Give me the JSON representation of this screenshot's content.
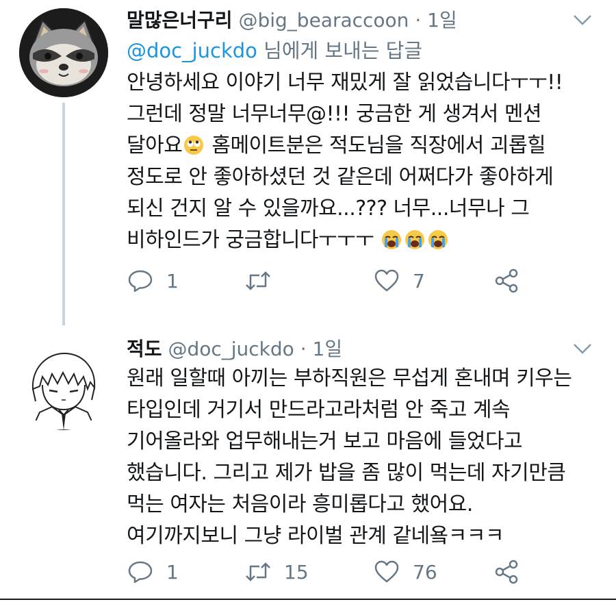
{
  "tweets": [
    {
      "name": "말많은너구리",
      "handle": "@big_bearaccoon",
      "dot": "·",
      "time": "1일",
      "reply_to": {
        "mention": "@doc_juckdo",
        "suffix": " 님에게 보내는 답글"
      },
      "avatar_icon": "raccoon-avatar",
      "body_lines": [
        "안녕하세요 이야기 너무 재밌게 잘 읽었습니다ㅜㅜ!!",
        "그런데 정말 너무너무@!!! 궁금한 게 생겨서 멘션",
        "달아요",
        " 홈메이트분은 적도님을 직장에서 괴롭힐",
        "정도로 안 좋아하셨던 것 같은데 어쩌다가 좋아하게",
        "되신 건지 알 수 있을까요...??? 너무...너무나 그",
        "비하인드가 궁금합니다ㅜㅜㅜ"
      ],
      "emojis": [
        "rolling-eyes-emoji",
        "crying-emoji",
        "crying-emoji",
        "crying-emoji"
      ],
      "actions": {
        "reply_count": "1",
        "retweet_count": "",
        "like_count": "7"
      }
    },
    {
      "name": "적도",
      "handle": "@doc_juckdo",
      "dot": "·",
      "time": "1일",
      "avatar_icon": "manga-boy-avatar",
      "body_lines": [
        "원래 일할때 아끼는 부하직원은 무섭게 혼내며 키우는",
        "타입인데 거기서 만드라고라처럼 안 죽고 계속",
        "기어올라와 업무해내는거 보고 마음에 들었다고",
        "했습니다. 그리고 제가 밥을 좀 많이 먹는데 자기만큼",
        "먹는 여자는 처음이라 흥미롭다고 했어요.",
        "여기까지보니 그냥 라이벌 관계 같네욬ㅋㅋㅋ"
      ],
      "actions": {
        "reply_count": "1",
        "retweet_count": "15",
        "like_count": "76"
      }
    }
  ],
  "colors": {
    "text": "#14171a",
    "muted": "#657786",
    "link": "#1b95e0",
    "thread_line": "#c9d3dc"
  }
}
